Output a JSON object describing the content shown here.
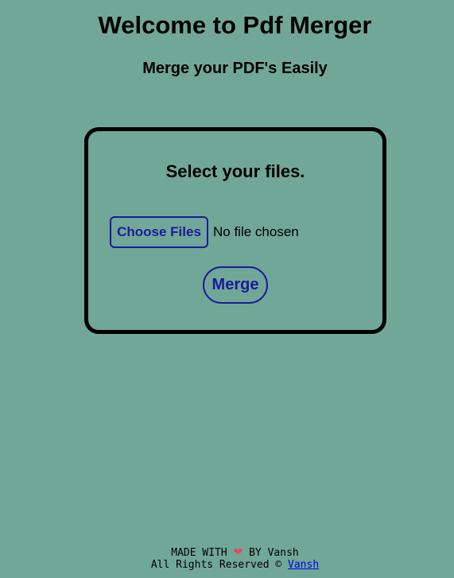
{
  "header": {
    "title": "Welcome to Pdf Merger",
    "subtitle": "Merge your PDF's Easily"
  },
  "card": {
    "heading": "Select your files.",
    "choose_files_label": "Choose Files",
    "file_status": "No file chosen",
    "merge_label": "Merge"
  },
  "footer": {
    "made_with": "MADE WITH",
    "heart_icon": "heart-icon",
    "by": "BY Vansh",
    "rights": "All Rights Reserved ©",
    "author_link": "Vansh"
  },
  "colors": {
    "background": "#71a796",
    "accent": "#1a1aa0",
    "heart": "#e8475f",
    "link": "#0000ee"
  }
}
